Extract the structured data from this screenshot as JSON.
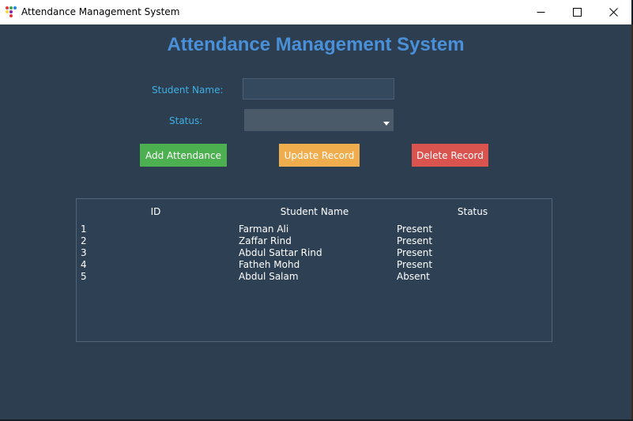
{
  "window": {
    "title": "Attendance Management System",
    "minimize_glyph": "—",
    "maximize_glyph": "☐",
    "close_glyph": "✕"
  },
  "heading": "Attendance Management System",
  "form": {
    "student_name_label": "Student Name:",
    "student_name_value": "",
    "status_label": "Status:",
    "status_value": ""
  },
  "buttons": {
    "add": "Add Attendance",
    "update": "Update Record",
    "delete": "Delete Record"
  },
  "colors": {
    "background": "#2c3e50",
    "heading": "#4a90d9",
    "label": "#3fb0e4",
    "add_button": "#4caf50",
    "update_button": "#f0ad4e",
    "delete_button": "#d9534f"
  },
  "table": {
    "headers": [
      "ID",
      "Student Name",
      "Status"
    ],
    "rows": [
      {
        "id": "1",
        "name": "Farman Ali",
        "status": "Present"
      },
      {
        "id": "2",
        "name": "Zaffar Rind",
        "status": "Present"
      },
      {
        "id": "3",
        "name": "Abdul Sattar Rind",
        "status": "Present"
      },
      {
        "id": "4",
        "name": "Fatheh Mohd",
        "status": "Present"
      },
      {
        "id": "5",
        "name": "Abdul Salam",
        "status": "Absent"
      }
    ]
  }
}
